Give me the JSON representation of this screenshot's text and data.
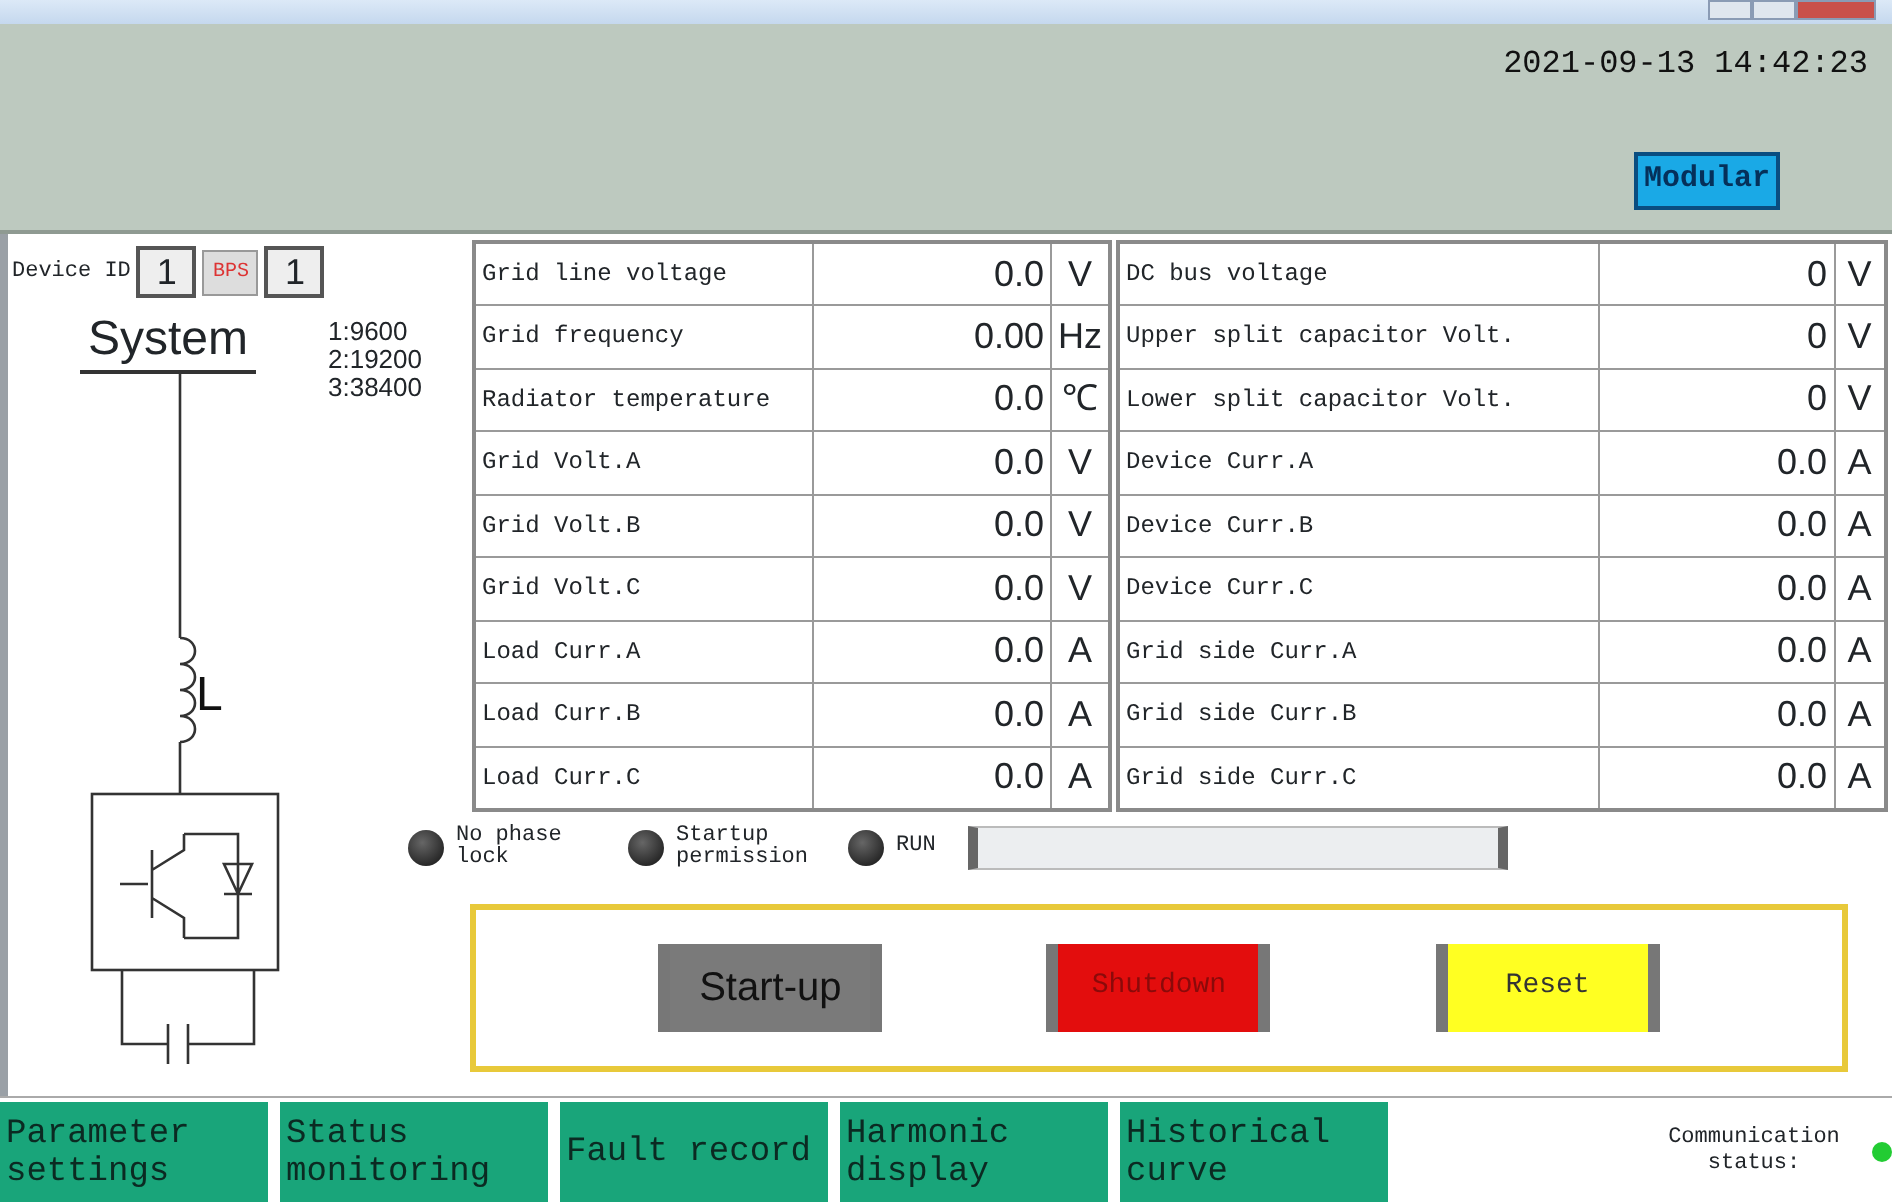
{
  "header": {
    "datetime": "2021-09-13  14:42:23",
    "mode_badge": "Modular"
  },
  "device": {
    "id_label": "Device ID",
    "id_value": "1",
    "bps_button": "BPS",
    "bps_value": "1",
    "system_label": "System",
    "baud_rates": [
      "1:9600",
      "2:19200",
      "3:38400"
    ],
    "inductor_label": "L"
  },
  "left_table": [
    {
      "label": "Grid line voltage",
      "value": "0.0",
      "unit": "V"
    },
    {
      "label": "Grid frequency",
      "value": "0.00",
      "unit": "Hz"
    },
    {
      "label": "Radiator temperature",
      "value": "0.0",
      "unit": "℃"
    },
    {
      "label": "Grid Volt.A",
      "value": "0.0",
      "unit": "V"
    },
    {
      "label": "Grid Volt.B",
      "value": "0.0",
      "unit": "V"
    },
    {
      "label": "Grid Volt.C",
      "value": "0.0",
      "unit": "V"
    },
    {
      "label": "Load Curr.A",
      "value": "0.0",
      "unit": "A"
    },
    {
      "label": "Load Curr.B",
      "value": "0.0",
      "unit": "A"
    },
    {
      "label": "Load Curr.C",
      "value": "0.0",
      "unit": "A"
    }
  ],
  "right_table": [
    {
      "label": "DC bus voltage",
      "value": "0",
      "unit": "V"
    },
    {
      "label": "Upper split capacitor Volt.",
      "value": "0",
      "unit": "V"
    },
    {
      "label": "Lower split capacitor Volt.",
      "value": "0",
      "unit": "V"
    },
    {
      "label": "Device Curr.A",
      "value": "0.0",
      "unit": "A"
    },
    {
      "label": "Device Curr.B",
      "value": "0.0",
      "unit": "A"
    },
    {
      "label": "Device Curr.C",
      "value": "0.0",
      "unit": "A"
    },
    {
      "label": "Grid side Curr.A",
      "value": "0.0",
      "unit": "A"
    },
    {
      "label": "Grid side Curr.B",
      "value": "0.0",
      "unit": "A"
    },
    {
      "label": "Grid side Curr.C",
      "value": "0.0",
      "unit": "A"
    }
  ],
  "indicators": [
    {
      "label": "No phase lock",
      "on": false
    },
    {
      "label": "Startup permission",
      "on": false
    },
    {
      "label": "RUN",
      "on": false
    }
  ],
  "progress": {
    "level": 0
  },
  "buttons": [
    {
      "label": "Start-up",
      "kind": "startup"
    },
    {
      "label": "Shutdown",
      "kind": "shutdown"
    },
    {
      "label": "Reset",
      "kind": "reset"
    }
  ],
  "nav_tabs": [
    {
      "label": "Parameter settings",
      "selected": false
    },
    {
      "label": "Status monitoring",
      "selected": false
    },
    {
      "label": "Fault record",
      "selected": false
    },
    {
      "label": "Harmonic display",
      "selected": false
    },
    {
      "label": "Historical curve",
      "selected": false
    }
  ],
  "communication": {
    "label": "Communication status:",
    "connected": true
  }
}
